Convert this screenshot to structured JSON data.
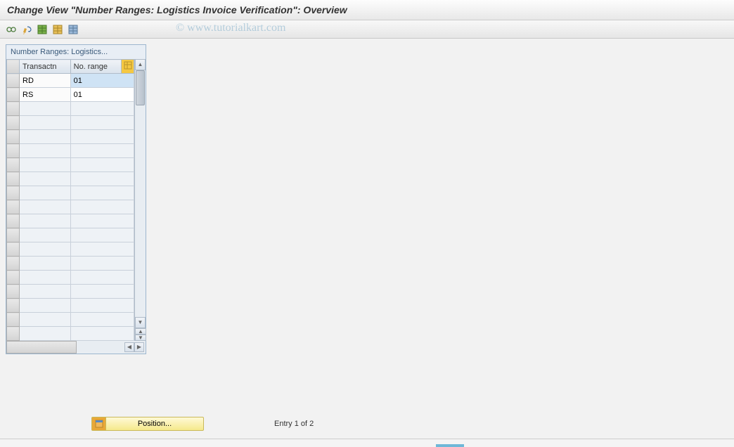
{
  "title": "Change View \"Number Ranges: Logistics Invoice Verification\": Overview",
  "watermark": "© www.tutorialkart.com",
  "toolbar": {
    "icons": [
      "other-view",
      "change",
      "table-view",
      "save",
      "select-all"
    ]
  },
  "panel": {
    "title": "Number Ranges: Logistics...",
    "columns": {
      "transaction": "Transactn",
      "number_range": "No. range"
    },
    "rows": [
      {
        "transaction": "RD",
        "no_range": "01",
        "selected": true
      },
      {
        "transaction": "RS",
        "no_range": "01",
        "selected": false
      }
    ],
    "empty_rows": 17
  },
  "footer": {
    "position_button": "Position...",
    "entry_status": "Entry 1 of 2"
  }
}
